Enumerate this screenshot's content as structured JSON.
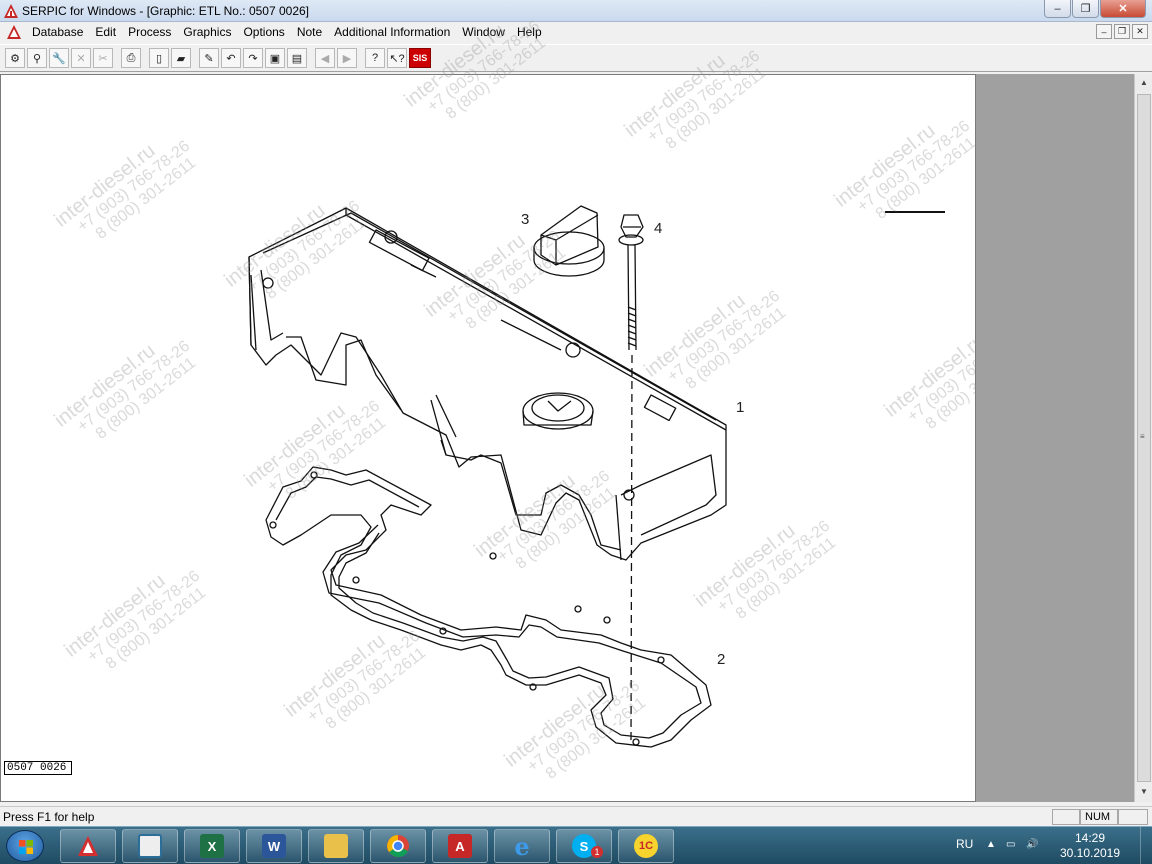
{
  "window": {
    "title": "SERPIC for Windows - [Graphic: ETL No.: 0507 0026]",
    "minimize": "–",
    "maximize": "❐",
    "close": "✕"
  },
  "menu": {
    "items": [
      "Database",
      "Edit",
      "Process",
      "Graphics",
      "Options",
      "Note",
      "Additional Information",
      "Window",
      "Help"
    ],
    "mdi_minimize": "–",
    "mdi_restore": "❐",
    "mdi_close": "✕"
  },
  "toolbar": {
    "sis_label": "SIS",
    "help_label": "?",
    "context_help_label": "↖?"
  },
  "drawing": {
    "id_box": "0507 0026",
    "callouts": [
      {
        "label": "1"
      },
      {
        "label": "2"
      },
      {
        "label": "3"
      },
      {
        "label": "4"
      }
    ],
    "parts": [
      "cylinder-head-cover",
      "gasket",
      "oil-filler-cap",
      "bolt"
    ]
  },
  "watermark": {
    "site": "inter-diesel.ru",
    "phone1": "+7 (903) 766-78-26",
    "phone2": "8 (800) 301-2611"
  },
  "statusbar": {
    "hint": "Press F1 for help",
    "num": "NUM"
  },
  "taskbar": {
    "apps": [
      "serpic",
      "explorer-window",
      "excel",
      "word",
      "file-explorer",
      "chrome",
      "pdf-reader",
      "internet-explorer",
      "skype",
      "1c"
    ],
    "app_glyphs": {
      "excel": "X",
      "word": "W",
      "pdf": "A",
      "ie": "e",
      "skype": "S",
      "onec": "1C"
    },
    "skype_badge": "1",
    "language": "RU",
    "time": "14:29",
    "date": "30.10.2019"
  },
  "colors": {
    "title_bar": "#c9d9ee",
    "taskbar": "#1f4b63",
    "right_panel": "#a0a0a0",
    "drawing_bg": "#ffffff"
  }
}
